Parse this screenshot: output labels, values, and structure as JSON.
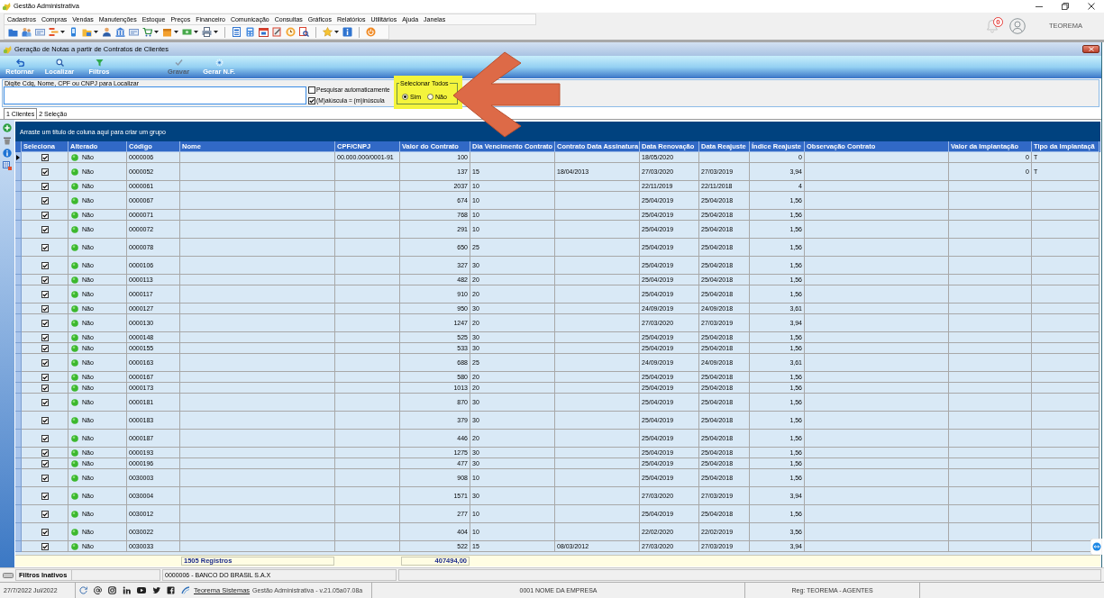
{
  "window": {
    "title": "Gestão Administrativa"
  },
  "menu": [
    "Cadastros",
    "Compras",
    "Vendas",
    "Manutenções",
    "Estoque",
    "Preços",
    "Financeiro",
    "Comunicação",
    "Consultas",
    "Gráficos",
    "Relatórios",
    "Utilitários",
    "Ajuda",
    "Janelas"
  ],
  "account": {
    "notifications": "0",
    "user": "TEOREMA"
  },
  "form": {
    "title": "Geração de Notas a partir de Contratos de Clientes",
    "toolbar": [
      {
        "label": "Retornar",
        "disabled": false
      },
      {
        "label": "Localizar",
        "disabled": false
      },
      {
        "label": "Filtros",
        "disabled": false
      },
      {
        "label": "Gravar",
        "disabled": true
      },
      {
        "label": "Gerar N.F.",
        "disabled": false
      }
    ],
    "search": {
      "label": "Digite Cdg, Nome, CPF ou CNPJ para Localizar"
    },
    "options": [
      {
        "label": "Pesquisar automaticamente",
        "checked": false
      },
      {
        "label": "(M)aiúscula = (m)inúscula",
        "checked": true
      }
    ],
    "select_all": {
      "label": "Selecionar Todos",
      "options": [
        {
          "label": "Sim",
          "selected": true
        },
        {
          "label": "Não",
          "selected": false
        }
      ]
    },
    "tabs": [
      {
        "label": "1 Clientes",
        "selected": true
      },
      {
        "label": "2 Seleção",
        "selected": false
      }
    ],
    "group_panel": "Arraste um título de coluna aqui para criar um grupo",
    "table": {
      "columns": [
        "Seleciona",
        "Alterado",
        "Código",
        "Nome",
        "CPF/CNPJ",
        "Valor do Contrato",
        "Dia Vencimento Contrato",
        "Contrato Data Assinatura",
        "Data Renovação",
        "Data Reajuste",
        "Índice Reajuste",
        "Observação Contrato",
        "Valor da Implantação",
        "Tipo da Implantaçã"
      ],
      "rows": [
        {
          "checked": true,
          "current": true,
          "wrapped": false,
          "alterado": "Não",
          "codigo": "0000006",
          "cpf_cnpj": "00.000.000/0001-91",
          "valor_contrato": "100",
          "data_renovacao": "18/05/2020",
          "indice_reajuste": "0",
          "valor_implantacao": "0",
          "tipo_implantacao": "T"
        },
        {
          "checked": true,
          "current": false,
          "wrapped": true,
          "alterado": "Não",
          "codigo": "0000052",
          "valor_contrato": "137",
          "dia_vencimento": "15",
          "data_assinatura": "18/04/2013",
          "data_renovacao": "27/03/2020",
          "data_reajuste": "27/03/2019",
          "indice_reajuste": "3,94",
          "valor_implantacao": "0",
          "tipo_implantacao": "T"
        },
        {
          "checked": true,
          "current": false,
          "wrapped": false,
          "alterado": "Não",
          "codigo": "0000061",
          "valor_contrato": "2037",
          "dia_vencimento": "10",
          "data_renovacao": "22/11/2019",
          "data_reajuste": "22/11/2018",
          "indice_reajuste": "4"
        },
        {
          "checked": true,
          "current": false,
          "wrapped": true,
          "alterado": "Não",
          "codigo": "0000067",
          "valor_contrato": "674",
          "dia_vencimento": "10",
          "data_renovacao": "25/04/2019",
          "data_reajuste": "25/04/2018",
          "indice_reajuste": "1,56"
        },
        {
          "checked": true,
          "current": false,
          "wrapped": false,
          "alterado": "Não",
          "codigo": "0000071",
          "valor_contrato": "768",
          "dia_vencimento": "10",
          "data_renovacao": "25/04/2019",
          "data_reajuste": "25/04/2018",
          "indice_reajuste": "1,56"
        },
        {
          "checked": true,
          "current": false,
          "wrapped": true,
          "alterado": "Não",
          "codigo": "0000072",
          "valor_contrato": "291",
          "dia_vencimento": "10",
          "data_renovacao": "25/04/2019",
          "data_reajuste": "25/04/2018",
          "indice_reajuste": "1,56"
        },
        {
          "checked": true,
          "current": false,
          "wrapped": true,
          "alterado": "Não",
          "codigo": "0000078",
          "valor_contrato": "650",
          "dia_vencimento": "25",
          "data_renovacao": "25/04/2019",
          "data_reajuste": "25/04/2018",
          "indice_reajuste": "1,56"
        },
        {
          "checked": true,
          "current": false,
          "wrapped": true,
          "alterado": "Não",
          "codigo": "0000106",
          "valor_contrato": "327",
          "dia_vencimento": "30",
          "data_renovacao": "25/04/2019",
          "data_reajuste": "25/04/2018",
          "indice_reajuste": "1,56"
        },
        {
          "checked": true,
          "current": false,
          "wrapped": false,
          "alterado": "Não",
          "codigo": "0000113",
          "valor_contrato": "482",
          "dia_vencimento": "20",
          "data_renovacao": "25/04/2019",
          "data_reajuste": "25/04/2018",
          "indice_reajuste": "1,56"
        },
        {
          "checked": true,
          "current": false,
          "wrapped": true,
          "alterado": "Não",
          "codigo": "0000117",
          "valor_contrato": "910",
          "dia_vencimento": "20",
          "data_renovacao": "25/04/2019",
          "data_reajuste": "25/04/2018",
          "indice_reajuste": "1,56"
        },
        {
          "checked": true,
          "current": false,
          "wrapped": false,
          "alterado": "Não",
          "codigo": "0000127",
          "valor_contrato": "950",
          "dia_vencimento": "30",
          "data_renovacao": "24/09/2019",
          "data_reajuste": "24/09/2018",
          "indice_reajuste": "3,61"
        },
        {
          "checked": true,
          "current": false,
          "wrapped": true,
          "alterado": "Não",
          "codigo": "0000130",
          "valor_contrato": "1247",
          "dia_vencimento": "20",
          "data_renovacao": "27/03/2020",
          "data_reajuste": "27/03/2019",
          "indice_reajuste": "3,94"
        },
        {
          "checked": true,
          "current": false,
          "wrapped": false,
          "alterado": "Não",
          "codigo": "0000148",
          "valor_contrato": "525",
          "dia_vencimento": "30",
          "data_renovacao": "25/04/2019",
          "data_reajuste": "25/04/2018",
          "indice_reajuste": "1,56"
        },
        {
          "checked": true,
          "current": false,
          "wrapped": false,
          "alterado": "Não",
          "codigo": "0000155",
          "valor_contrato": "533",
          "dia_vencimento": "30",
          "data_renovacao": "25/04/2019",
          "data_reajuste": "25/04/2018",
          "indice_reajuste": "1,56"
        },
        {
          "checked": true,
          "current": false,
          "wrapped": true,
          "alterado": "Não",
          "codigo": "0000163",
          "valor_contrato": "688",
          "dia_vencimento": "25",
          "data_renovacao": "24/09/2019",
          "data_reajuste": "24/09/2018",
          "indice_reajuste": "3,61"
        },
        {
          "checked": true,
          "current": false,
          "wrapped": false,
          "alterado": "Não",
          "codigo": "0000167",
          "valor_contrato": "580",
          "dia_vencimento": "20",
          "data_renovacao": "25/04/2019",
          "data_reajuste": "25/04/2018",
          "indice_reajuste": "1,56"
        },
        {
          "checked": true,
          "current": false,
          "wrapped": false,
          "alterado": "Não",
          "codigo": "0000173",
          "valor_contrato": "1013",
          "dia_vencimento": "20",
          "data_renovacao": "25/04/2019",
          "data_reajuste": "25/04/2018",
          "indice_reajuste": "1,56"
        },
        {
          "checked": true,
          "current": false,
          "wrapped": true,
          "alterado": "Não",
          "codigo": "0000181",
          "valor_contrato": "870",
          "dia_vencimento": "30",
          "data_renovacao": "25/04/2019",
          "data_reajuste": "25/04/2018",
          "indice_reajuste": "1,56"
        },
        {
          "checked": true,
          "current": false,
          "wrapped": true,
          "alterado": "Não",
          "codigo": "0000183",
          "valor_contrato": "379",
          "dia_vencimento": "30",
          "data_renovacao": "25/04/2019",
          "data_reajuste": "25/04/2018",
          "indice_reajuste": "1,56"
        },
        {
          "checked": true,
          "current": false,
          "wrapped": true,
          "alterado": "Não",
          "codigo": "0000187",
          "valor_contrato": "446",
          "dia_vencimento": "20",
          "data_renovacao": "25/04/2019",
          "data_reajuste": "25/04/2018",
          "indice_reajuste": "1,56"
        },
        {
          "checked": true,
          "current": false,
          "wrapped": false,
          "alterado": "Não",
          "codigo": "0000193",
          "valor_contrato": "1275",
          "dia_vencimento": "30",
          "data_renovacao": "25/04/2019",
          "data_reajuste": "25/04/2018",
          "indice_reajuste": "1,56"
        },
        {
          "checked": true,
          "current": false,
          "wrapped": false,
          "alterado": "Não",
          "codigo": "0000196",
          "valor_contrato": "477",
          "dia_vencimento": "30",
          "data_renovacao": "25/04/2019",
          "data_reajuste": "25/04/2018",
          "indice_reajuste": "1,56"
        },
        {
          "checked": true,
          "current": false,
          "wrapped": true,
          "alterado": "Não",
          "codigo": "0030003",
          "valor_contrato": "908",
          "dia_vencimento": "10",
          "data_renovacao": "25/04/2019",
          "data_reajuste": "25/04/2018",
          "indice_reajuste": "1,56"
        },
        {
          "checked": true,
          "current": false,
          "wrapped": true,
          "alterado": "Não",
          "codigo": "0030004",
          "valor_contrato": "1571",
          "dia_vencimento": "30",
          "data_renovacao": "27/03/2020",
          "data_reajuste": "27/03/2019",
          "indice_reajuste": "3,94"
        },
        {
          "checked": true,
          "current": false,
          "wrapped": true,
          "alterado": "Não",
          "codigo": "0030012",
          "valor_contrato": "277",
          "dia_vencimento": "10",
          "data_renovacao": "25/04/2019",
          "data_reajuste": "25/04/2018",
          "indice_reajuste": "1,56"
        },
        {
          "checked": true,
          "current": false,
          "wrapped": true,
          "alterado": "Não",
          "codigo": "0030022",
          "valor_contrato": "404",
          "dia_vencimento": "10",
          "data_renovacao": "22/02/2020",
          "data_reajuste": "22/02/2019",
          "indice_reajuste": "3,56"
        },
        {
          "checked": true,
          "current": false,
          "wrapped": false,
          "alterado": "Não",
          "codigo": "0030033",
          "valor_contrato": "522",
          "dia_vencimento": "15",
          "data_assinatura": "08/03/2012",
          "data_renovacao": "27/03/2020",
          "data_reajuste": "27/03/2019",
          "indice_reajuste": "3,94"
        }
      ],
      "footer": {
        "count": "1505 Registros",
        "total": "407494,00"
      }
    }
  },
  "filter_bar": {
    "label": "Filtros Inativos",
    "record": "0000006 - BANCO DO BRASIL S.A.X"
  },
  "status_bar": {
    "date": "27/7/2022 Jul/2022",
    "link": "Teorema Sistemas",
    "version": "Gestão Administrativa - v.21.05a07.08a",
    "company": "0001 NOME DA EMPRESA",
    "registration": "Reg: TEOREMA - AGENTES"
  }
}
